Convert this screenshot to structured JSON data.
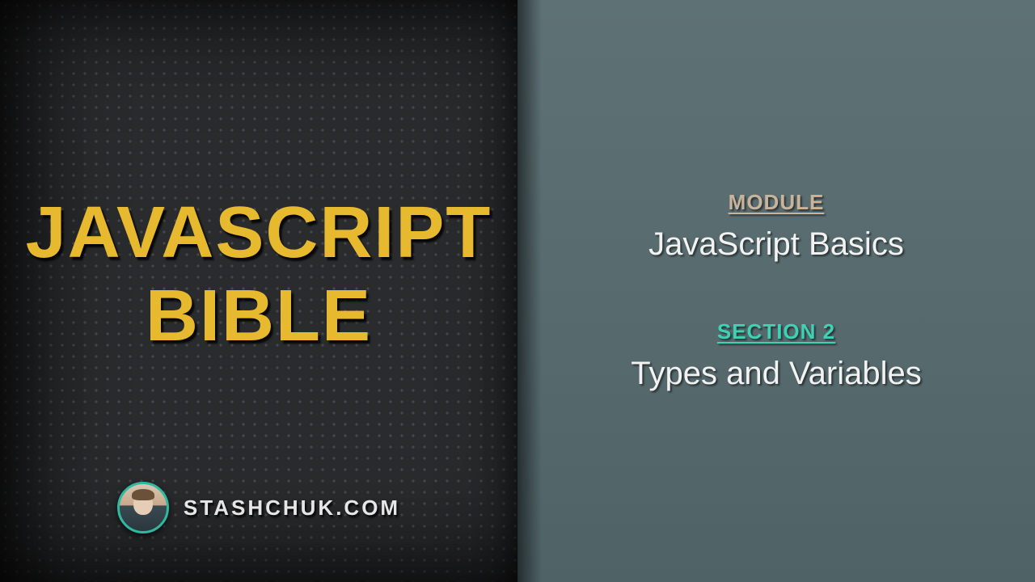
{
  "title": {
    "line1": "JAVASCRIPT",
    "line2": "BIBLE"
  },
  "author": {
    "site": "STASHCHUK.COM"
  },
  "module": {
    "label": "MODULE",
    "value": "JavaScript Basics"
  },
  "section": {
    "label": "SECTION 2",
    "value": "Types and Variables"
  },
  "colors": {
    "accent_yellow": "#e7b92e",
    "accent_teal": "#3fd1b4",
    "accent_tan": "#c9b49a"
  }
}
